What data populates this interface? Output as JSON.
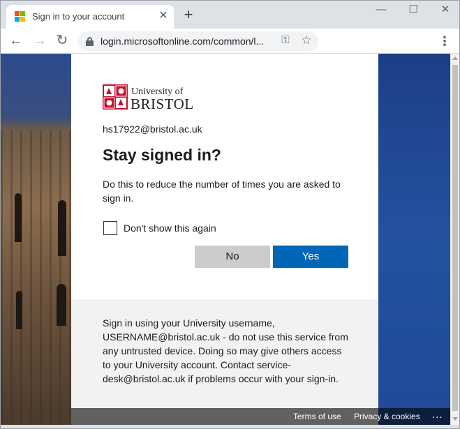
{
  "browser": {
    "tab_title": "Sign in to your account",
    "tab_close_glyph": "✕",
    "new_tab_glyph": "+",
    "window_controls": {
      "minimize": "—",
      "maximize": "☐",
      "close": "✕"
    },
    "nav": {
      "back": "←",
      "forward": "→",
      "reload": "↻"
    },
    "url": "login.microsoftonline.com/common/l...",
    "icons": {
      "key": "key-icon",
      "star": "star-icon",
      "menu": "menu-icon"
    },
    "menu_glyph": "⋮",
    "key_glyph": "⚿",
    "star_glyph": "☆",
    "favicon_colors": [
      "#f25022",
      "#7fba00",
      "#00a4ef",
      "#ffb900"
    ]
  },
  "signin": {
    "logo_line1": "University of",
    "logo_line2": "BRISTOL",
    "account_email": "hs17922@bristol.ac.uk",
    "heading": "Stay signed in?",
    "description": "Do this to reduce the number of times you are asked to sign in.",
    "checkbox_label": "Don't show this again",
    "checkbox_checked": false,
    "no_button": "No",
    "yes_button": "Yes",
    "accent_color": "#0067b8"
  },
  "notice": {
    "text": "Sign in using your University username, USERNAME@bristol.ac.uk - do not use this service from any untrusted device. Doing so may give others access to your University account. Contact service-desk@bristol.ac.uk if problems occur with your sign-in."
  },
  "footer": {
    "terms": "Terms of use",
    "privacy": "Privacy & cookies",
    "more": "..."
  }
}
